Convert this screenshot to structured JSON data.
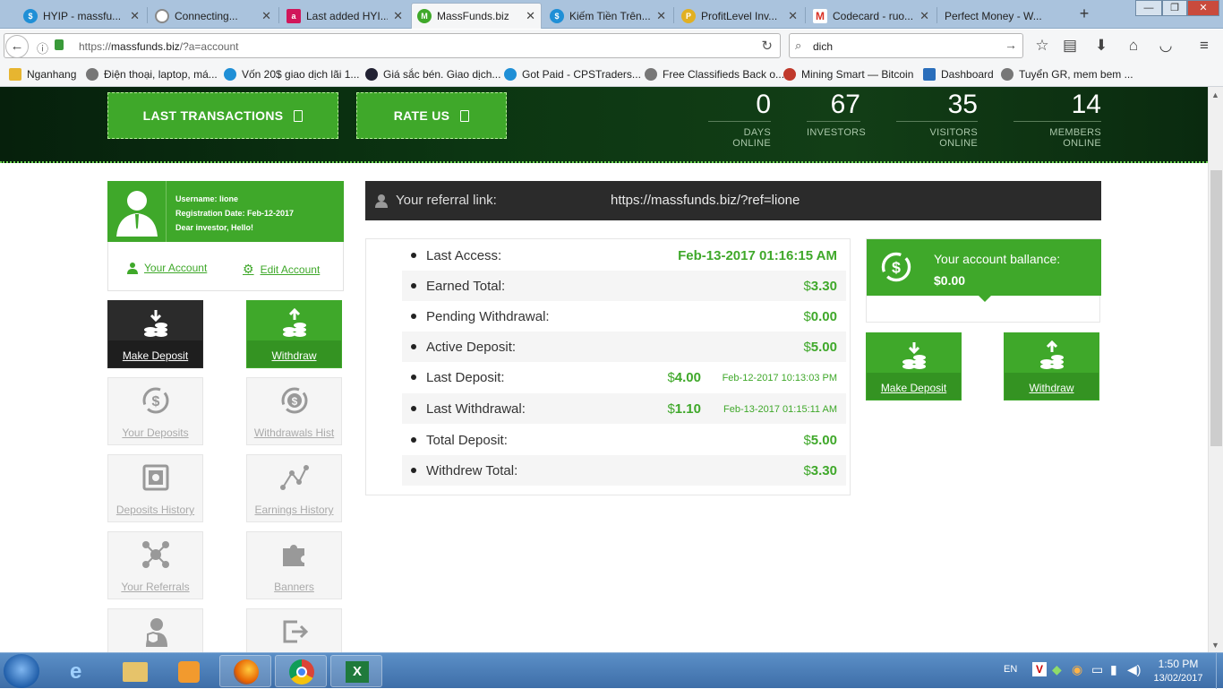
{
  "tabs": [
    {
      "title": "HYIP - massfu...",
      "icon": "dollar-circle-icon",
      "color": "#1f8fd6"
    },
    {
      "title": "Connecting...",
      "icon": "loading-spinner-icon",
      "color": "#888888"
    },
    {
      "title": "Last added HYI...",
      "icon": "letter-a-icon",
      "color": "#d1165a"
    },
    {
      "title": "MassFunds.biz",
      "icon": "massfunds-logo-icon",
      "color": "#3fa82a"
    },
    {
      "title": "Kiếm Tiền Trên...",
      "icon": "dollar-circle-icon",
      "color": "#1f8fd6"
    },
    {
      "title": "ProfitLevel Inv...",
      "icon": "profitlevel-icon",
      "color": "#e1b022"
    },
    {
      "title": "Codecard - ruo...",
      "icon": "gmail-icon",
      "color": "#d93025"
    },
    {
      "title": "Perfect Money - W...",
      "icon": "",
      "color": ""
    }
  ],
  "url": {
    "scheme": "https://",
    "host": "massfunds.biz",
    "path": "/?a=account"
  },
  "search": {
    "value": "dich"
  },
  "bookmarks": [
    "Nganhang",
    "Điện thoại, laptop, má...",
    "Vốn 20$ giao dịch lãi 1...",
    "Giá sắc bén. Giao dịch...",
    "Got Paid - CPSTraders...",
    "Free Classifieds Back o...",
    "Mining Smart — Bitcoin",
    "Dashboard",
    "Tuyển GR, mem bem ..."
  ],
  "top_buttons": {
    "last_transactions": "LAST TRANSACTIONS",
    "rate_us": "RATE US"
  },
  "stats": [
    {
      "value": "0",
      "label": "DAYS ONLINE"
    },
    {
      "value": "67",
      "label": "INVESTORS"
    },
    {
      "value": "35",
      "label": "VISITORS ONLINE"
    },
    {
      "value": "14",
      "label": "MEMBERS ONLINE"
    }
  ],
  "profile": {
    "username": "Username: lione",
    "registration": "Registration Date: Feb-12-2017",
    "greeting": "Dear investor, Hello!"
  },
  "account_links": {
    "your_account": "Your Account",
    "edit_account": "Edit Account"
  },
  "menu": {
    "make_deposit": "Make Deposit",
    "withdraw": "Withdraw",
    "your_deposits": "Your Deposits",
    "withdrawals_hist": "Withdrawals Hist",
    "deposits_history": "Deposits History",
    "earnings_history": "Earnings History",
    "your_referrals": "Your Referrals",
    "banners": "Banners"
  },
  "referral": {
    "label": "Your referral link:",
    "value": "https://massfunds.biz/?ref=lione"
  },
  "summary": {
    "last_access_label": "Last Access:",
    "last_access": "Feb-13-2017 01:16:15 AM",
    "earned_total_label": "Earned Total:",
    "earned_total": "3.30",
    "pending_withdrawal_label": "Pending Withdrawal:",
    "pending_withdrawal": "0.00",
    "active_deposit_label": "Active Deposit:",
    "active_deposit": "5.00",
    "last_deposit_label": "Last Deposit:",
    "last_deposit": "4.00",
    "last_deposit_date": "Feb-12-2017 10:13:03 PM",
    "last_withdrawal_label": "Last Withdrawal:",
    "last_withdrawal": "1.10",
    "last_withdrawal_date": "Feb-13-2017 01:15:11 AM",
    "total_deposit_label": "Total Deposit:",
    "total_deposit": "5.00",
    "withdrew_total_label": "Withdrew Total:",
    "withdrew_total": "3.30",
    "currency": "$"
  },
  "balance": {
    "label": "Your account ballance:",
    "amount": "$0.00"
  },
  "side_buttons": {
    "make_deposit": "Make Deposit",
    "withdraw": "Withdraw"
  },
  "taskbar": {
    "language": "EN",
    "time": "1:50 PM",
    "date": "13/02/2017"
  }
}
